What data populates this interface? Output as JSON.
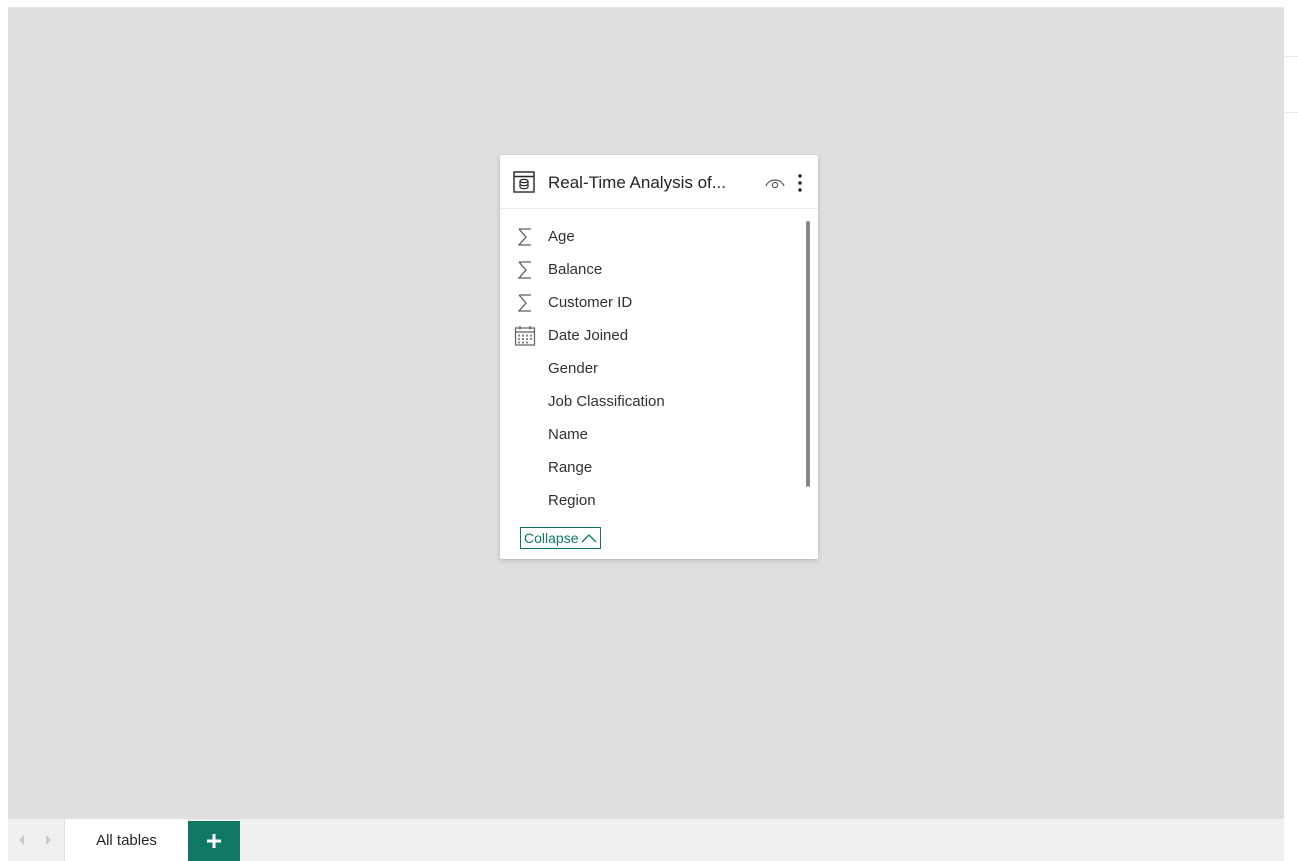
{
  "model_view": {
    "table_card": {
      "title": "Real-Time Analysis of...",
      "fields": [
        {
          "name": "Age",
          "icon": "sigma-icon"
        },
        {
          "name": "Balance",
          "icon": "sigma-icon"
        },
        {
          "name": "Customer ID",
          "icon": "sigma-icon"
        },
        {
          "name": "Date Joined",
          "icon": "calendar-icon"
        },
        {
          "name": "Gender",
          "icon": ""
        },
        {
          "name": "Job Classification",
          "icon": ""
        },
        {
          "name": "Name",
          "icon": ""
        },
        {
          "name": "Range",
          "icon": ""
        },
        {
          "name": "Region",
          "icon": ""
        }
      ],
      "collapse_label": "Collapse"
    }
  },
  "tab_bar": {
    "tabs": [
      {
        "label": "All tables",
        "active": true
      }
    ],
    "add_tab_icon": "plus-icon"
  },
  "colors": {
    "canvas_bg": "#e1dfdd",
    "accent": "#117865",
    "text": "#252423"
  }
}
